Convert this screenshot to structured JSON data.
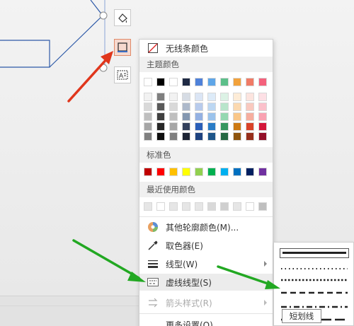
{
  "menu": {
    "no_line_color": "无线条颜色",
    "theme_colors_label": "主题颜色",
    "standard_colors_label": "标准色",
    "recent_colors_label": "最近使用颜色",
    "other_colors": "其他轮廓颜色(M)...",
    "eyedropper": "取色器(E)",
    "line_type": "线型(W)",
    "dash_type": "虚线线型(S)",
    "arrow_style": "箭头样式(R)",
    "more_settings": "更多设置(O)..."
  },
  "tooltip": {
    "text": "短划线"
  },
  "colors": {
    "theme_top": [
      "#ffffff",
      "#000000",
      "#ffffff",
      "#1f2a44",
      "#4f81d9",
      "#5fa6e8",
      "#5cbf8a",
      "#f2a23c",
      "#f07b66",
      "#f4617c"
    ],
    "theme_tints": [
      [
        "#f2f2f2",
        "#7f7f7f",
        "#f2f2f2",
        "#d6dce4",
        "#dbe5f5",
        "#ddebf8",
        "#dcf2e5",
        "#fdecd7",
        "#fce4df",
        "#fde0e5"
      ],
      [
        "#d9d9d9",
        "#595959",
        "#d9d9d9",
        "#adb9ca",
        "#b8cbec",
        "#bcd7f2",
        "#b9e5cb",
        "#fbd9b0",
        "#f9c9bf",
        "#fbc1cb"
      ],
      [
        "#bfbfbf",
        "#3f3f3f",
        "#bfbfbf",
        "#8497b0",
        "#94b1e2",
        "#9bc3ec",
        "#96d8b1",
        "#f9c789",
        "#f6ae9f",
        "#f9a2b2"
      ],
      [
        "#a6a6a6",
        "#262626",
        "#a6a6a6",
        "#33405c",
        "#2b5fb8",
        "#2a7cc6",
        "#37965f",
        "#cc7a14",
        "#d94329",
        "#d3173a"
      ],
      [
        "#7f7f7f",
        "#0d0d0d",
        "#7f7f7f",
        "#1c2333",
        "#1e427f",
        "#1d5589",
        "#266842",
        "#8e550e",
        "#972f1c",
        "#930f28"
      ]
    ],
    "standard": [
      "#c00000",
      "#ff0000",
      "#ffc000",
      "#ffff00",
      "#92d050",
      "#00b050",
      "#00b0f0",
      "#0070c0",
      "#002060",
      "#7030a0"
    ],
    "recent": [
      "#e6e6e6",
      "#ffffff",
      "#e6e6e6",
      "#e6e6e6",
      "#e6e6e6",
      "#d9d9d9",
      "#cfcfcf",
      "#e6e6e6",
      "#ffffff",
      "#bfbfbf"
    ],
    "accent_red": "#e0361c",
    "accent_green": "#22a822"
  }
}
